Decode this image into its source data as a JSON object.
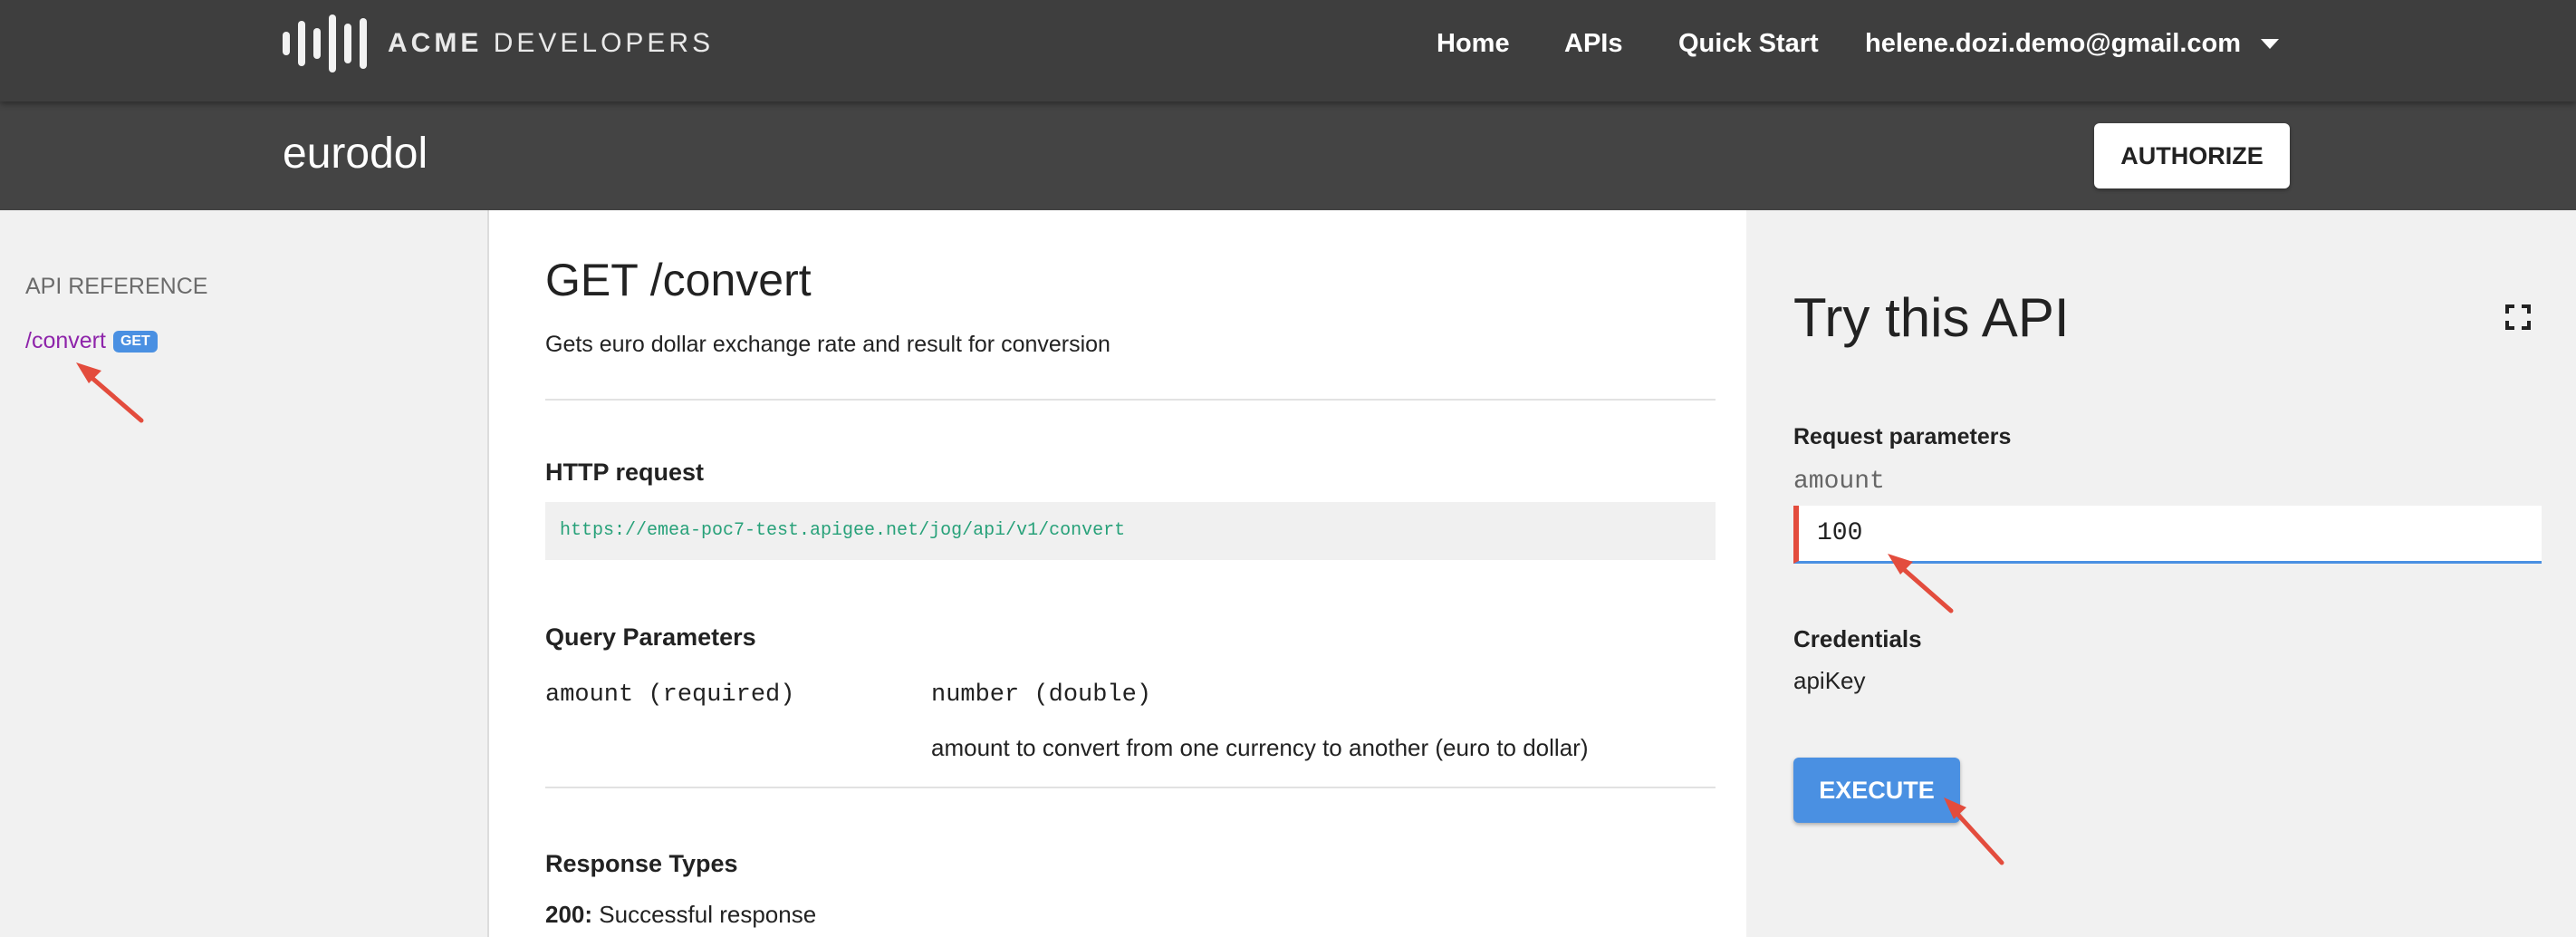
{
  "brand": {
    "name_bold": "ACME",
    "name_rest": "DEVELOPERS"
  },
  "nav": {
    "home": "Home",
    "apis": "APIs",
    "quick_start": "Quick Start",
    "user_email": "helene.dozi.demo@gmail.com"
  },
  "api": {
    "name": "eurodol",
    "authorize_label": "AUTHORIZE"
  },
  "sidebar": {
    "heading": "API REFERENCE",
    "items": [
      {
        "label": "/convert",
        "method": "GET"
      }
    ]
  },
  "operation": {
    "title": "GET /convert",
    "description": "Gets euro dollar exchange rate and result for conversion",
    "http_request_heading": "HTTP request",
    "url": "https://emea-poc7-test.apigee.net/jog/api/v1/convert",
    "query_params_heading": "Query Parameters",
    "params": [
      {
        "name": "amount (required)",
        "type": "number (double)",
        "description": "amount to convert from one currency to another (euro to dollar)"
      }
    ],
    "response_types_heading": "Response Types",
    "responses": [
      {
        "code": "200:",
        "description": "Successful response"
      }
    ]
  },
  "try_panel": {
    "title": "Try this API",
    "request_params_heading": "Request parameters",
    "amount_label": "amount",
    "amount_value": "100",
    "credentials_heading": "Credentials",
    "credentials_value": "apiKey",
    "execute_label": "EXECUTE"
  },
  "colors": {
    "topbar": "#3e3e3e",
    "subheader": "#444444",
    "accent_blue": "#4a90e2",
    "link_purple": "#8e24aa",
    "url_green": "#27a179",
    "annotation_red": "#e34c3d",
    "input_error_red": "#e34c3d"
  },
  "icons": {
    "logo": "sound-bars-logo",
    "user_menu": "caret-down-icon",
    "expand": "fullscreen-expand-icon",
    "annotation": "red-arrow"
  }
}
